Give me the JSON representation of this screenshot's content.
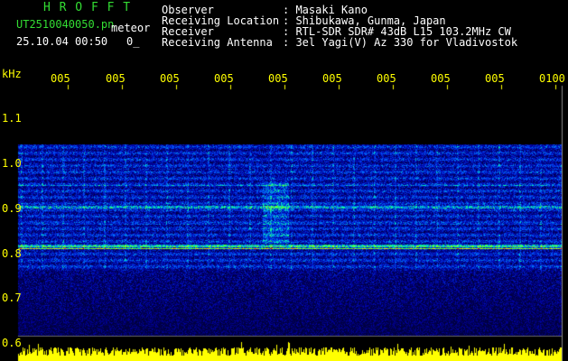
{
  "header": {
    "app_name": "H R O F F T",
    "file_name": "UT2510040050.pn",
    "mode": "meteor",
    "datetime": "25.10.04 00:50",
    "counter": "0_",
    "fields": [
      {
        "label": "Observer",
        "value": ": Masaki Kano"
      },
      {
        "label": "Receiving Location",
        "value": ": Shibukawa, Gunma, Japan"
      },
      {
        "label": "Receiver",
        "value": ": RTL-SDR SDR# 43dB L15 103.2MHz CW"
      },
      {
        "label": "Receiving Antenna",
        "value": ": 3el Yagi(V) Az 330 for Vladivostok"
      }
    ]
  },
  "axes": {
    "y_unit": "kHz",
    "y_ticks": [
      "1.1",
      "1.0",
      "0.9",
      "0.8",
      "0.7",
      "0.6"
    ],
    "x_ticks": [
      "005",
      "005",
      "005",
      "005",
      "005",
      "005",
      "005",
      "005",
      "005",
      "0100"
    ]
  },
  "colors": {
    "header_green": "#33dd33",
    "text_white": "#ffffff",
    "tick_yellow": "#ffff00",
    "background": "#000000"
  }
}
